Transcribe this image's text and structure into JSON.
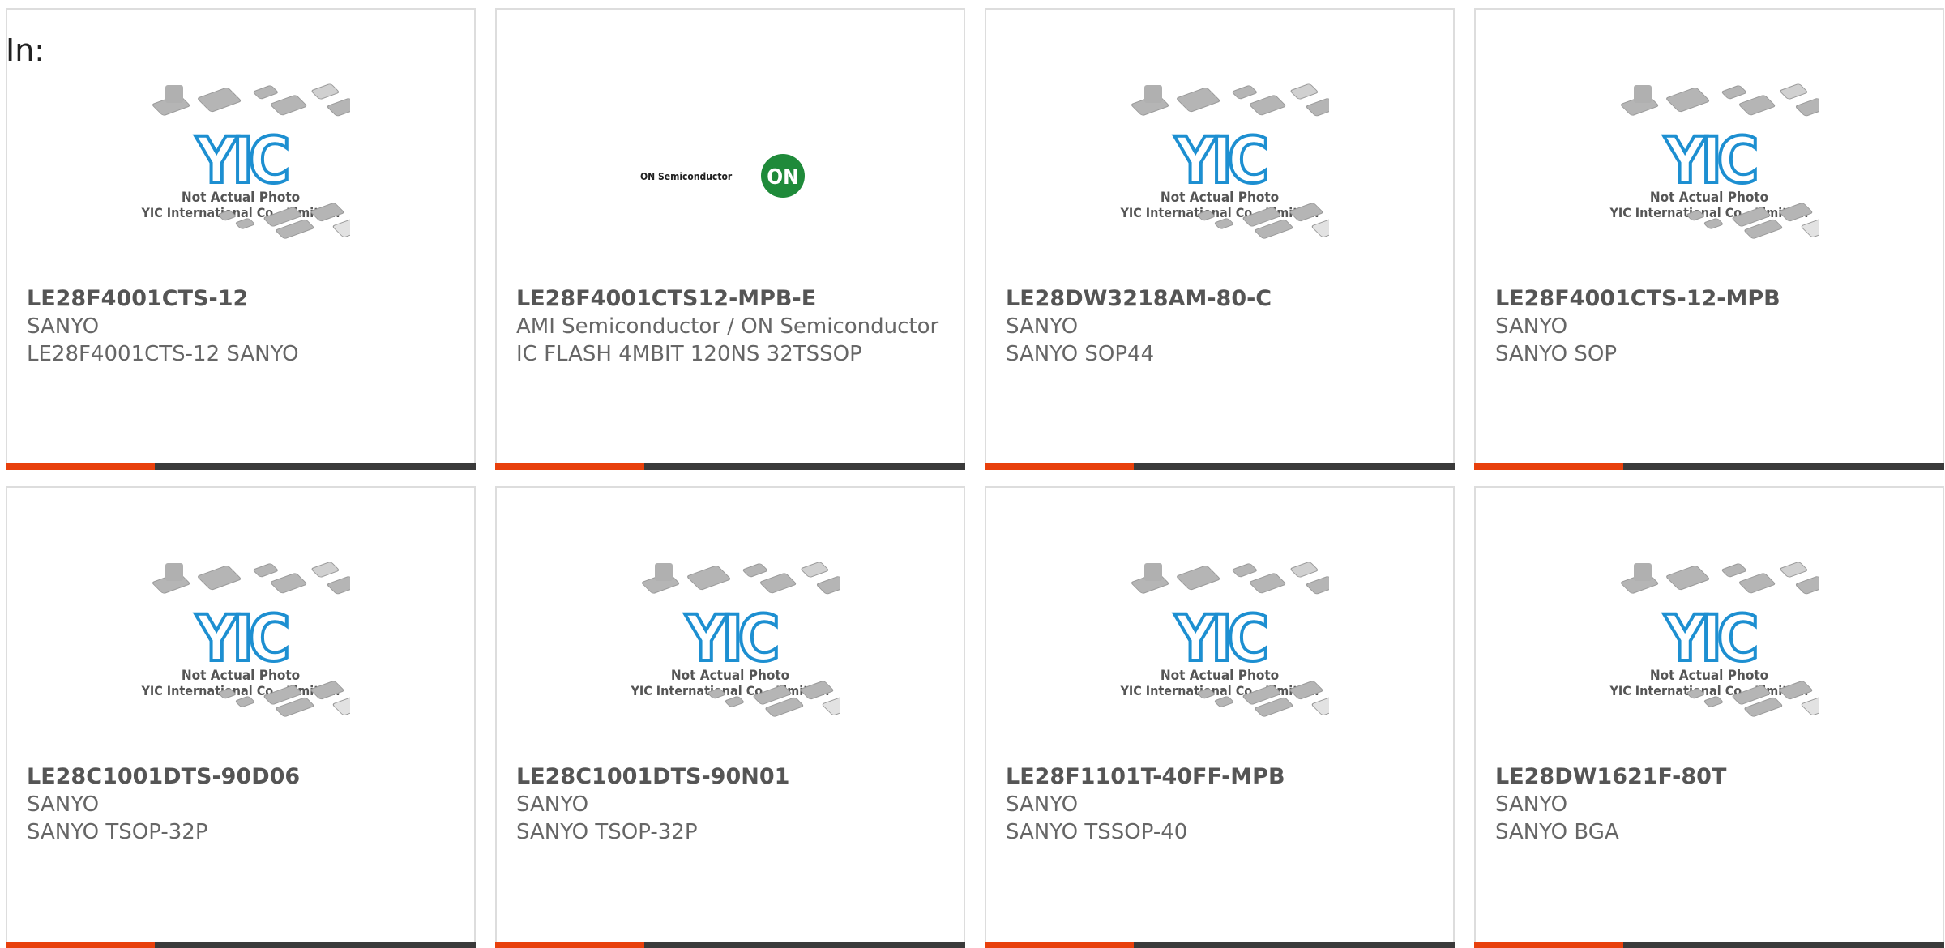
{
  "filter_label": "In:",
  "placeholder": {
    "caption_line1": "Not Actual Photo",
    "caption_line2": "YIC International Co., Limited.",
    "logo_text": "YIC"
  },
  "on_semi": {
    "wordmark": "ON Semiconductor",
    "badge": "ON"
  },
  "colors": {
    "accent": "#e8400c",
    "bar": "#3a3a3a",
    "yic_blue": "#1d8fd1"
  },
  "products": [
    {
      "part_number": "LE28F4001CTS-12",
      "manufacturer": "SANYO",
      "description": "LE28F4001CTS-12 SANYO",
      "image": "yic"
    },
    {
      "part_number": "LE28F4001CTS12-MPB-E",
      "manufacturer": "AMI Semiconductor / ON Semiconductor",
      "description": "IC FLASH 4MBIT 120NS 32TSSOP",
      "image": "onsemi"
    },
    {
      "part_number": "LE28DW3218AM-80-C",
      "manufacturer": "SANYO",
      "description": "SANYO SOP44",
      "image": "yic"
    },
    {
      "part_number": "LE28F4001CTS-12-MPB",
      "manufacturer": "SANYO",
      "description": "SANYO SOP",
      "image": "yic"
    },
    {
      "part_number": "LE28C1001DTS-90D06",
      "manufacturer": "SANYO",
      "description": "SANYO TSOP-32P",
      "image": "yic"
    },
    {
      "part_number": "LE28C1001DTS-90N01",
      "manufacturer": "SANYO",
      "description": "SANYO TSOP-32P",
      "image": "yic"
    },
    {
      "part_number": "LE28F1101T-40FF-MPB",
      "manufacturer": "SANYO",
      "description": "SANYO TSSOP-40",
      "image": "yic"
    },
    {
      "part_number": "LE28DW1621F-80T",
      "manufacturer": "SANYO",
      "description": "SANYO BGA",
      "image": "yic"
    }
  ]
}
